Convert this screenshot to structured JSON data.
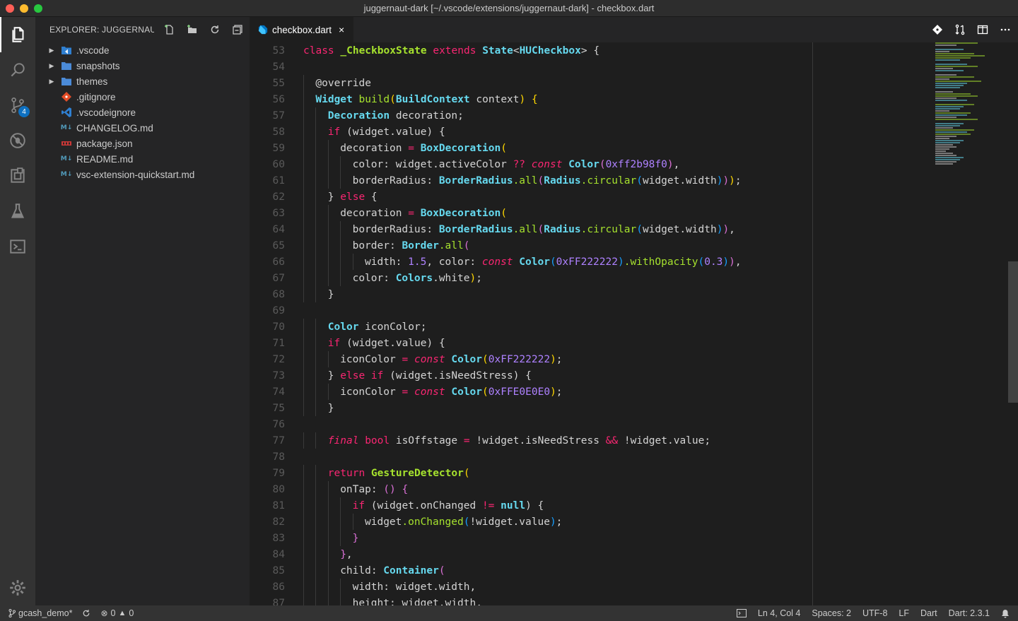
{
  "window": {
    "title": "juggernaut-dark [~/.vscode/extensions/juggernaut-dark] - checkbox.dart"
  },
  "activity": {
    "scm_badge": "4"
  },
  "explorer": {
    "title": "EXPLORER: JUGGERNAU...",
    "items": [
      {
        "label": ".vscode",
        "kind": "folder"
      },
      {
        "label": "snapshots",
        "kind": "folder"
      },
      {
        "label": "themes",
        "kind": "folder"
      },
      {
        "label": ".gitignore",
        "kind": "file"
      },
      {
        "label": ".vscodeignore",
        "kind": "file"
      },
      {
        "label": "CHANGELOG.md",
        "kind": "file"
      },
      {
        "label": "package.json",
        "kind": "file"
      },
      {
        "label": "README.md",
        "kind": "file"
      },
      {
        "label": "vsc-extension-quickstart.md",
        "kind": "file"
      }
    ]
  },
  "tab": {
    "label": "checkbox.dart",
    "close": "×"
  },
  "editor": {
    "line_numbers": [
      "53",
      "54",
      "55",
      "56",
      "57",
      "58",
      "59",
      "60",
      "61",
      "62",
      "63",
      "64",
      "65",
      "66",
      "67",
      "68",
      "69",
      "70",
      "71",
      "72",
      "73",
      "74",
      "75",
      "76",
      "77",
      "78",
      "79",
      "80",
      "81",
      "82",
      "83",
      "84",
      "85",
      "86",
      "87"
    ]
  },
  "status": {
    "branch": "gcash_demo*",
    "errors": "0",
    "warnings": "0",
    "position": "Ln 4, Col 4",
    "spaces": "Spaces: 2",
    "encoding": "UTF-8",
    "eol": "LF",
    "language": "Dart",
    "sdk": "Dart: 2.3.1"
  },
  "colors": {
    "accent": "#0e70c0",
    "keyword": "#f92672",
    "type": "#66d9ef",
    "function": "#a6e22e",
    "number": "#ae81ff"
  }
}
